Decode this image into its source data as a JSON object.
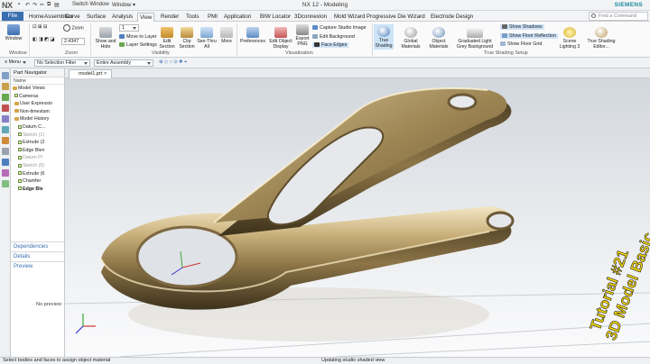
{
  "app": {
    "logo": "NX",
    "window_title": "NX 12 - Modeling",
    "brand": "SIEMENS",
    "switch_window": "Switch Window",
    "window_menu": "Window"
  },
  "menu": {
    "file": "File",
    "tabs": [
      "Home",
      "Assemblies",
      "Curve",
      "Surface",
      "Analysis",
      "View",
      "Render",
      "Tools",
      "PMI",
      "Application",
      "BIW Locator",
      "3Dconnexion",
      "Mold Wizard",
      "Progressive Die Wizard",
      "Electrode Design"
    ],
    "active_tab": "View"
  },
  "search": {
    "placeholder": "Find a Command"
  },
  "ribbon": {
    "window_btn": "Window",
    "zoom_label": "Zoom",
    "zoom_value": "2.4347",
    "zoom_group": "Zoom",
    "window_group": "Window",
    "layer_value": "1",
    "show_hide": "Show and Hide",
    "move_to_layer": "Move to Layer",
    "layer_settings": "Layer Settings",
    "edit_section": "Edit Section",
    "clip_section": "Clip Section",
    "see_thru": "See-Thru All",
    "more": "More",
    "visibility_group": "Visibility",
    "preferences": "Preferences",
    "edit_object_display": "Edit Object Display",
    "export_png": "Export PNG",
    "capture_studio_image": "Capture Studio Image",
    "edit_background": "Edit Background",
    "face_edges": "Face Edges",
    "visualization_group": "Visualization",
    "true_shading": "True Shading",
    "global_materials": "Global Materials",
    "object_materials": "Object Materials",
    "graduated_light_grey_background": "Graduated Light Grey Background",
    "show_shadows": "Show Shadows",
    "show_floor_reflection": "Show Floor Reflection",
    "show_floor_grid": "Show Floor Grid",
    "scene_lighting": "Scene Lighting 3",
    "true_shading_editor": "True Shading Editor...",
    "true_shading_setup_group": "True Shading Setup"
  },
  "filterbar": {
    "menu": "Menu",
    "selection_filter": "No Selection Filter",
    "assembly": "Entire Assembly"
  },
  "navigator": {
    "title": "Part Navigator",
    "column": "Name",
    "items": [
      {
        "label": "Model Views",
        "style": "normal",
        "icon": "folder"
      },
      {
        "label": "Cameras",
        "style": "normal",
        "icon": "check"
      },
      {
        "label": "User Expressio",
        "style": "normal",
        "icon": "folder"
      },
      {
        "label": "Non-timestam",
        "style": "normal",
        "icon": "folder"
      },
      {
        "label": "Model History",
        "style": "normal",
        "icon": "folder"
      },
      {
        "label": "Datum C...",
        "style": "normal",
        "icon": "check"
      },
      {
        "label": "Sketch (1)",
        "style": "grey",
        "icon": "check"
      },
      {
        "label": "Extrude (2",
        "style": "normal",
        "icon": "check"
      },
      {
        "label": "Edge Blen",
        "style": "normal",
        "icon": "check"
      },
      {
        "label": "Datum Pl",
        "style": "grey",
        "icon": "check"
      },
      {
        "label": "Sketch (5)",
        "style": "grey",
        "icon": "check"
      },
      {
        "label": "Extrude (6",
        "style": "normal",
        "icon": "check"
      },
      {
        "label": "Chamfer",
        "style": "normal",
        "icon": "check"
      },
      {
        "label": "Edge Ble",
        "style": "bold",
        "icon": "check"
      }
    ],
    "dependencies": "Dependencies",
    "details": "Details",
    "preview": "Preview",
    "no_preview": "No preview"
  },
  "viewport": {
    "tab": "model1.prt"
  },
  "banner": {
    "line1": "Tutorial #21",
    "line2": "3D Model Basic",
    "color": "#f5d800"
  },
  "status": {
    "left": "Select bodies and faces to assign object material",
    "center": "Updating studio shaded view"
  }
}
